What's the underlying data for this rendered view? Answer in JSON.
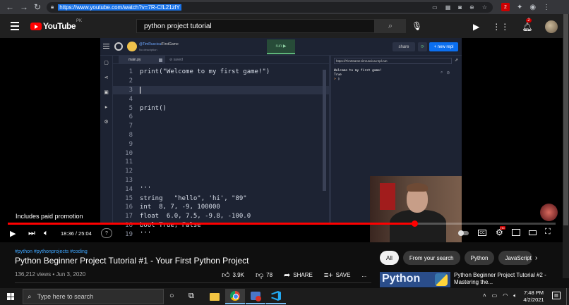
{
  "browser": {
    "url": "https://www.youtube.com/watch?v=7R-CfL21zlY",
    "extension_badge": "2"
  },
  "masthead": {
    "logo_text": "YouTube",
    "region": "PK",
    "search_query": "python project tutorial",
    "notification_count": "2"
  },
  "ide": {
    "repl_user": "@TimRuscica",
    "repl_path": "/FirstGame",
    "repl_description": "No description",
    "run_label": "run ▶",
    "share_label": "share",
    "new_repl_label": "+ new repl",
    "tab_label": "main.py",
    "saved_label": "saved",
    "console_url": "https://FirstGame.timruscica.repl.run",
    "console_output_1": "Welcome to my first game!",
    "console_output_2": "True",
    "console_prompt": "> ",
    "lines": [
      {
        "n": "1",
        "text": "print(\"Welcome to my first game!\")"
      },
      {
        "n": "2",
        "text": ""
      },
      {
        "n": "3",
        "text": ""
      },
      {
        "n": "4",
        "text": ""
      },
      {
        "n": "5",
        "text": "print()"
      },
      {
        "n": "6",
        "text": ""
      },
      {
        "n": "7",
        "text": ""
      },
      {
        "n": "8",
        "text": ""
      },
      {
        "n": "9",
        "text": ""
      },
      {
        "n": "10",
        "text": ""
      },
      {
        "n": "11",
        "text": ""
      },
      {
        "n": "12",
        "text": ""
      },
      {
        "n": "13",
        "text": ""
      },
      {
        "n": "14",
        "text": "'''"
      },
      {
        "n": "15",
        "text": "string   \"hello\", 'hi', \"89\""
      },
      {
        "n": "16",
        "text": "int  8, 7, -9, 100000"
      },
      {
        "n": "17",
        "text": "float  6.0, 7.5, -9.8, -100.0"
      },
      {
        "n": "18",
        "text": "bool True, False"
      },
      {
        "n": "19",
        "text": "'''"
      }
    ]
  },
  "player": {
    "promo_text": "Includes paid promotion",
    "time_text": "18:36 / 25:04",
    "progress_fraction": 0.742,
    "chapter_label": "?",
    "hd_badge": "HD"
  },
  "video": {
    "hashtags": "#python #pythonprojects #coding",
    "title": "Python Beginner Project Tutorial #1 - Your First Python Project",
    "views_date": "136,212 views • Jun 3, 2020",
    "likes": "3.9K",
    "dislikes": "78",
    "share_label": "SHARE",
    "save_label": "SAVE",
    "more_label": "..."
  },
  "chips": [
    "All",
    "From your search",
    "Python",
    "JavaScript"
  ],
  "recommendation": {
    "thumb_text": "Python",
    "title": "Python Beginner Project Tutorial #2 - Mastering the..."
  },
  "taskbar": {
    "search_placeholder": "Type here to search",
    "time": "7:48 PM",
    "date": "4/2/2021"
  }
}
